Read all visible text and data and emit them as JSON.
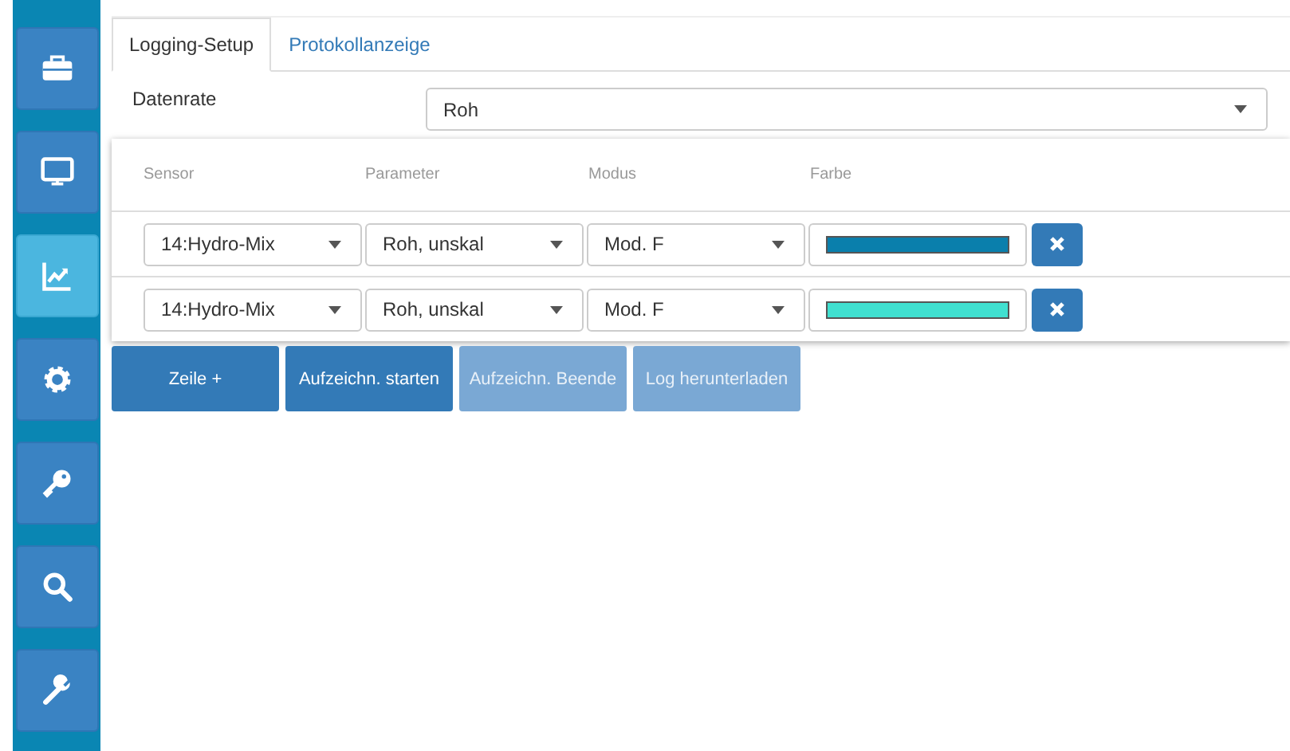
{
  "sidebar": {
    "items": [
      {
        "kind": "toolbox",
        "selected": false
      },
      {
        "kind": "monitor",
        "selected": false
      },
      {
        "kind": "chart",
        "selected": true
      },
      {
        "kind": "gear",
        "selected": false
      },
      {
        "kind": "key",
        "selected": false
      },
      {
        "kind": "search",
        "selected": false
      },
      {
        "kind": "wrench",
        "selected": false
      }
    ]
  },
  "tabs": [
    {
      "label": "Logging-Setup",
      "selected": true
    },
    {
      "label": "Protokollanzeige",
      "selected": false
    }
  ],
  "datenrate": {
    "label": "Datenrate",
    "value": "Roh"
  },
  "table": {
    "columns": [
      "Sensor",
      "Parameter",
      "Modus",
      "Farbe"
    ],
    "rows": [
      {
        "sensor": "14:Hydro-Mix",
        "parameter": "Roh, unskal",
        "modus": "Mod. F",
        "color": "#0a7fac"
      },
      {
        "sensor": "14:Hydro-Mix",
        "parameter": "Roh, unskal",
        "modus": "Mod. F",
        "color": "#40e0d0"
      }
    ]
  },
  "buttons": [
    {
      "label": "Zeile +",
      "disabled": false
    },
    {
      "label": "Aufzeichn. starten",
      "disabled": false
    },
    {
      "label": "Aufzeichn. Beende",
      "disabled": true
    },
    {
      "label": "Log herunterladen",
      "disabled": true
    }
  ]
}
